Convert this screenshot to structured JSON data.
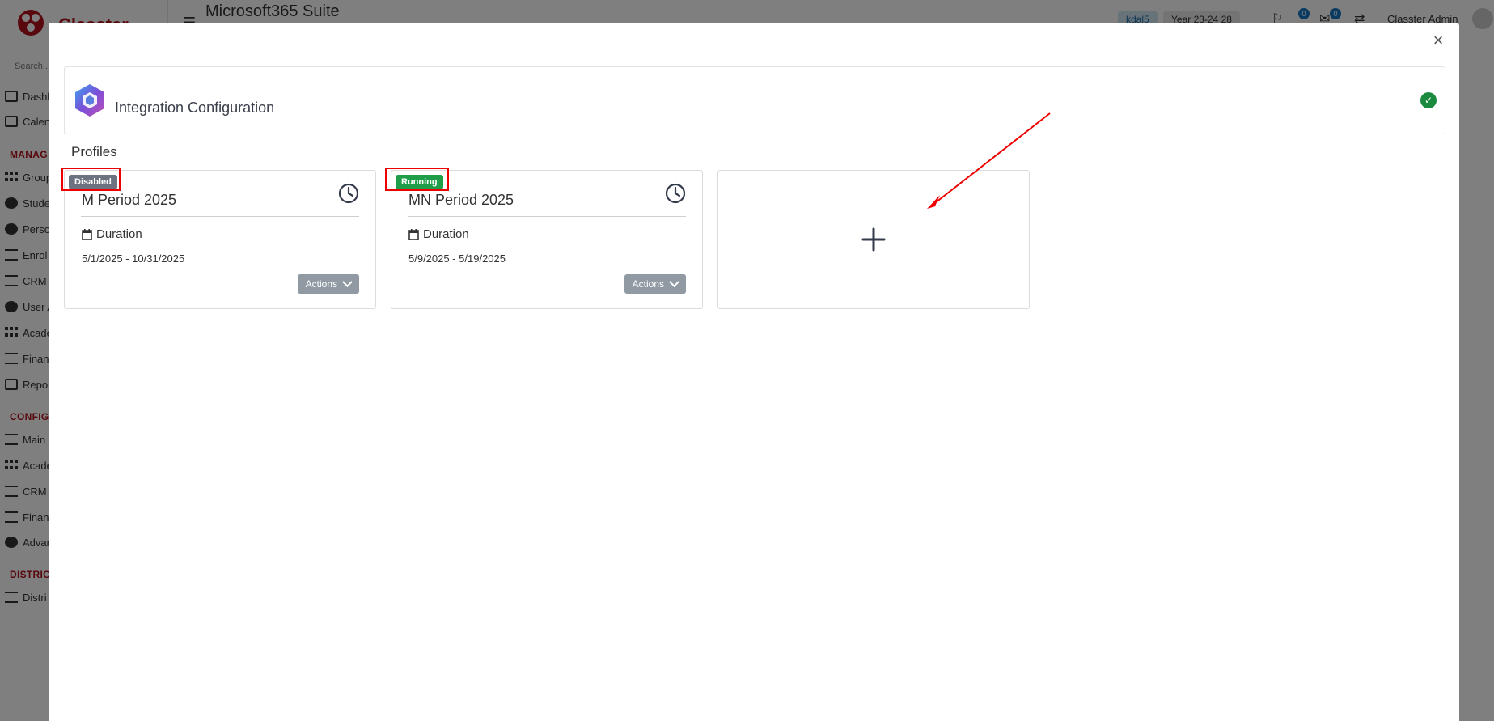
{
  "app": {
    "brand": "Classter",
    "search_placeholder": "Search...",
    "page_title": "Microsoft365 Suite",
    "nav_sections": [
      {
        "label": "MANAGE",
        "items": [
          "Dashboard",
          "Calendar"
        ]
      },
      {
        "label": "MANAGEMENT",
        "items": [
          "Groups",
          "Students",
          "Persons",
          "Enrollment",
          "CRM",
          "User Accounts",
          "Academics",
          "Finance",
          "Reports"
        ]
      },
      {
        "label": "CONFIGURATION",
        "items": [
          "Main",
          "Academics",
          "CRM Settings",
          "Finance",
          "Advanced"
        ]
      },
      {
        "label": "DISTRICT",
        "items": [
          "District"
        ]
      }
    ],
    "sidebar_visible": {
      "item_dashboard": "Dashl",
      "item_calendar": "Calen",
      "section_manage": "MANAG",
      "item_groups": "Group",
      "item_students": "Stude",
      "item_persons": "Perso",
      "item_enrollment": "Enrol",
      "item_crm": "CRM",
      "item_user": "User A",
      "item_academics": "Acade",
      "item_finance": "Finan",
      "item_reports": "Repo",
      "section_config": "CONFIG",
      "item_main": "Main",
      "item_academics2": "Acade",
      "item_crm2": "CRM S",
      "item_finance2": "Finan",
      "item_advanced": "Advan",
      "section_district": "DISTRIC",
      "item_district": "Distri"
    },
    "topbar": {
      "user_chip": "kdal5",
      "year_chip": "Year 23-24 28",
      "notif_count_1": "0",
      "notif_count_2": "0",
      "user_name": "Classter Admin"
    }
  },
  "modal": {
    "header_title": "Integration Configuration",
    "profiles_title": "Profiles",
    "profiles": [
      {
        "status": "Disabled",
        "name": "M Period 2025",
        "duration_label": "Duration",
        "dates": "5/1/2025 - 10/31/2025",
        "actions_label": "Actions"
      },
      {
        "status": "Running",
        "name": "MN Period 2025",
        "duration_label": "Duration",
        "dates": "5/9/2025 - 5/19/2025",
        "actions_label": "Actions"
      }
    ],
    "close_symbol": "×",
    "check_symbol": "✓"
  },
  "colors": {
    "brand_red": "#b3121b",
    "disabled_badge": "#6c7280",
    "running_badge": "#1f9d48",
    "success_check": "#1a8a3f",
    "highlight": "#ee0000",
    "actions_button": "#9199a3"
  },
  "icons": [
    "classter-logo",
    "microsoft365-icon",
    "check-circle-icon",
    "clock-icon",
    "calendar-icon",
    "chevron-down-icon",
    "plus-icon",
    "close-icon",
    "hamburger-icon",
    "flag-icon",
    "bell-icon",
    "mail-icon",
    "share-icon"
  ]
}
